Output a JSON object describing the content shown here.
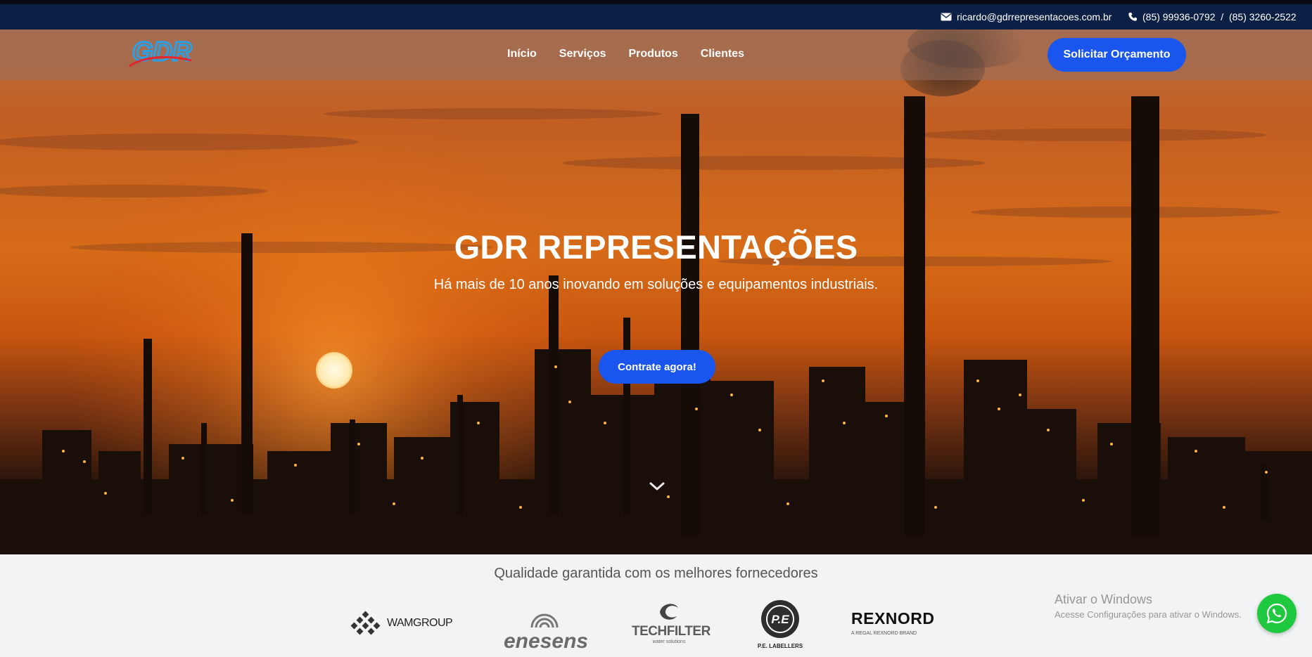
{
  "topbar": {
    "email": "ricardo@gdrrepresentacoes.com.br",
    "phones": "(85) 99936-0792  /  (85) 3260-2522",
    "email_icon": "envelope-icon",
    "phone_icon": "phone-icon"
  },
  "navbar": {
    "logo_text": "GDR",
    "links": [
      "Início",
      "Serviços",
      "Produtos",
      "Clientes"
    ],
    "quote_button": "Solicitar Orçamento"
  },
  "hero": {
    "title": "GDR REPRESENTAÇÕES",
    "subtitle": "Há mais de 10 anos inovando em soluções e equipamentos industriais.",
    "cta": "Contrate agora!",
    "scroll_icon": "chevron-down-icon"
  },
  "suppliers": {
    "title": "Qualidade garantida com os melhores fornecedores",
    "logos": {
      "wamgroup": "WAMGROUP",
      "enesens": "enesens",
      "techfilter": "TECHFILTER",
      "techfilter_sub": "water solutions",
      "pe_mark": "P.E",
      "pe_labellers": "P.E. LABELLERS",
      "rexnord": "REXNORD",
      "rexnord_sub": "A REGAL REXNORD BRAND"
    }
  },
  "windows_watermark": {
    "title": "Ativar o Windows",
    "subtitle": "Acesse Configurações para ativar o Windows."
  },
  "colors": {
    "topbar": "#0c1f45",
    "primary_button": "#1a56ee",
    "whatsapp": "#1ec93f"
  }
}
